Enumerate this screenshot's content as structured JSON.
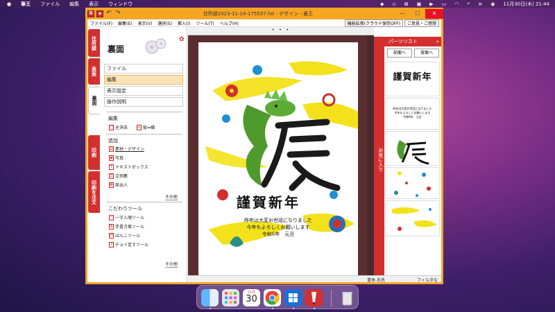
{
  "menubar": {
    "apple": "",
    "app": "筆王",
    "items": [
      "ファイル",
      "編集",
      "表示",
      "ウィンドウ"
    ],
    "datetime": "11月30日(木) 21:44"
  },
  "window": {
    "title": "住所録2023-11-14-175537.fxt - デザイン - 裏王"
  },
  "menu": {
    "items": [
      "ファイル(F)",
      "編集(E)",
      "表示(V)",
      "選択(S)",
      "挿入(I)",
      "ツール(T)",
      "ヘルプ(H)"
    ],
    "ext1": "機能拡張(クラウド保存OFF)",
    "ext2": "ご意見・ご感想"
  },
  "vtabs": [
    "住所録",
    "表面",
    "裏面",
    "印刷",
    "印刷を注文"
  ],
  "panel": {
    "title": "裏面",
    "menu": [
      "ファイル",
      "編集",
      "表示設定",
      "操作説明"
    ],
    "sec_edit": "編集",
    "edit_tools": [
      "全消去",
      "縦⇔横"
    ],
    "sec_add": "追加",
    "add_tools": [
      "素材・デザイン",
      "写真",
      "テキストボックス",
      "文例集",
      "差出人"
    ],
    "more": "その他",
    "sec_kodawari": "こだわりツール",
    "kodawari_tools": [
      "一字入魂ツール",
      "手書き風ツール",
      "はんこツール",
      "チョイ足すツール"
    ],
    "more2": "その他"
  },
  "ruler": "• • •",
  "card": {
    "greeting": "謹賀新年",
    "zodiac": "辰",
    "line1": "昨年は大変お世話になりました",
    "line2": "今年もよろしくお願いします",
    "line3": "令和6年　元旦"
  },
  "parts": {
    "title": "パーツリスト",
    "fav": "お気に入り",
    "prev": "前面へ",
    "back": "背面へ",
    "thumb_greet": "謹賀新年",
    "thumb_l1": "昨年は大変お世話になりました",
    "thumb_l2": "今年もよろしくお願いします",
    "thumb_l3": "令和6年　元旦"
  },
  "status": {
    "s1": "書体-氏名",
    "s2": "フィルタなし"
  },
  "dock": {
    "cal_month": "11月",
    "cal_day": "30"
  },
  "colors": {
    "accent": "#d32f2f",
    "window": "#f5a623",
    "canvas": "#5a2e2e",
    "dragon": "#4f9a2c"
  }
}
